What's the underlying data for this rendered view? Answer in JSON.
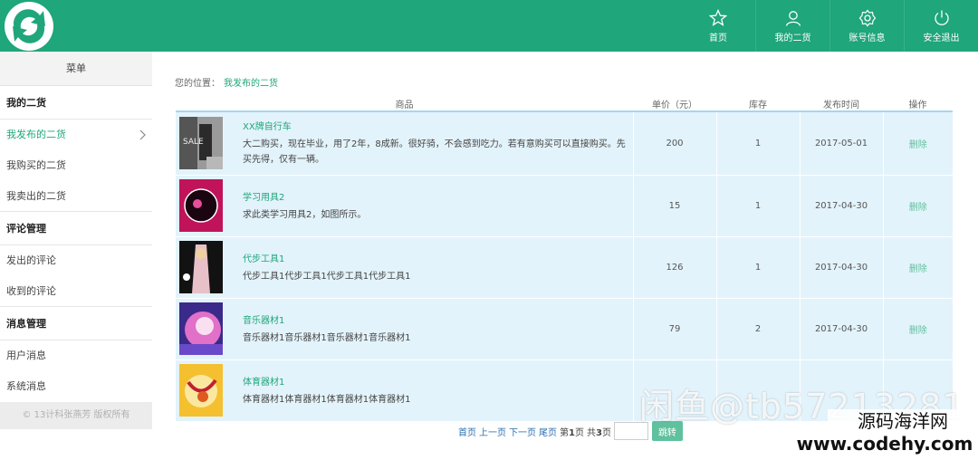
{
  "header": {
    "nav": [
      {
        "label": "首页",
        "icon": "star-icon"
      },
      {
        "label": "我的二货",
        "icon": "user-icon"
      },
      {
        "label": "账号信息",
        "icon": "gear-icon"
      },
      {
        "label": "安全退出",
        "icon": "power-icon"
      }
    ]
  },
  "sidebar": {
    "menu_title": "菜单",
    "groups": [
      {
        "title": "我的二货",
        "items": [
          "我发布的二货",
          "我购买的二货",
          "我卖出的二货"
        ]
      },
      {
        "title": "评论管理",
        "items": [
          "发出的评论",
          "收到的评论"
        ]
      },
      {
        "title": "消息管理",
        "items": [
          "用户消息",
          "系统消息"
        ]
      }
    ],
    "copyright": "© 13计科张燕芳 版权所有"
  },
  "breadcrumb": {
    "prefix": "您的位置：",
    "current": "我发布的二货"
  },
  "table": {
    "headers": [
      "商品",
      "单价（元）",
      "库存",
      "发布时间",
      "操作"
    ],
    "rows": [
      {
        "name": "XX牌自行车",
        "desc": "大二购买，现在毕业，用了2年，8成新。很好骑，不会感到吃力。若有意购买可以直接购买。先买先得，仅有一辆。",
        "price": "200",
        "stock": "1",
        "date": "2017-05-01",
        "action": "删除"
      },
      {
        "name": "学习用具2",
        "desc": "求此类学习用具2，如图所示。",
        "price": "15",
        "stock": "1",
        "date": "2017-04-30",
        "action": "删除"
      },
      {
        "name": "代步工具1",
        "desc": "代步工具1代步工具1代步工具1代步工具1",
        "price": "126",
        "stock": "1",
        "date": "2017-04-30",
        "action": "删除"
      },
      {
        "name": "音乐器材1",
        "desc": "音乐器材1音乐器材1音乐器材1音乐器材1",
        "price": "79",
        "stock": "2",
        "date": "2017-04-30",
        "action": "删除"
      },
      {
        "name": "体育器材1",
        "desc": "体育器材1体育器材1体育器材1体育器材1",
        "price": "",
        "stock": "",
        "date": "",
        "action": ""
      }
    ]
  },
  "pager": {
    "first": "首页",
    "prev": "上一页",
    "next": "下一页",
    "last": "尾页",
    "page_prefix": "第",
    "page": "1",
    "page_suffix": "页",
    "total_prefix": "共",
    "total": "3",
    "total_suffix": "页",
    "go": "跳转"
  },
  "watermark": {
    "line1": "闲鱼@tb57213281",
    "line2": "源码海洋网",
    "line3": "www.codehy.com"
  },
  "colors": {
    "brand": "#1fa67a",
    "row_bg": "#e3f3fb"
  }
}
